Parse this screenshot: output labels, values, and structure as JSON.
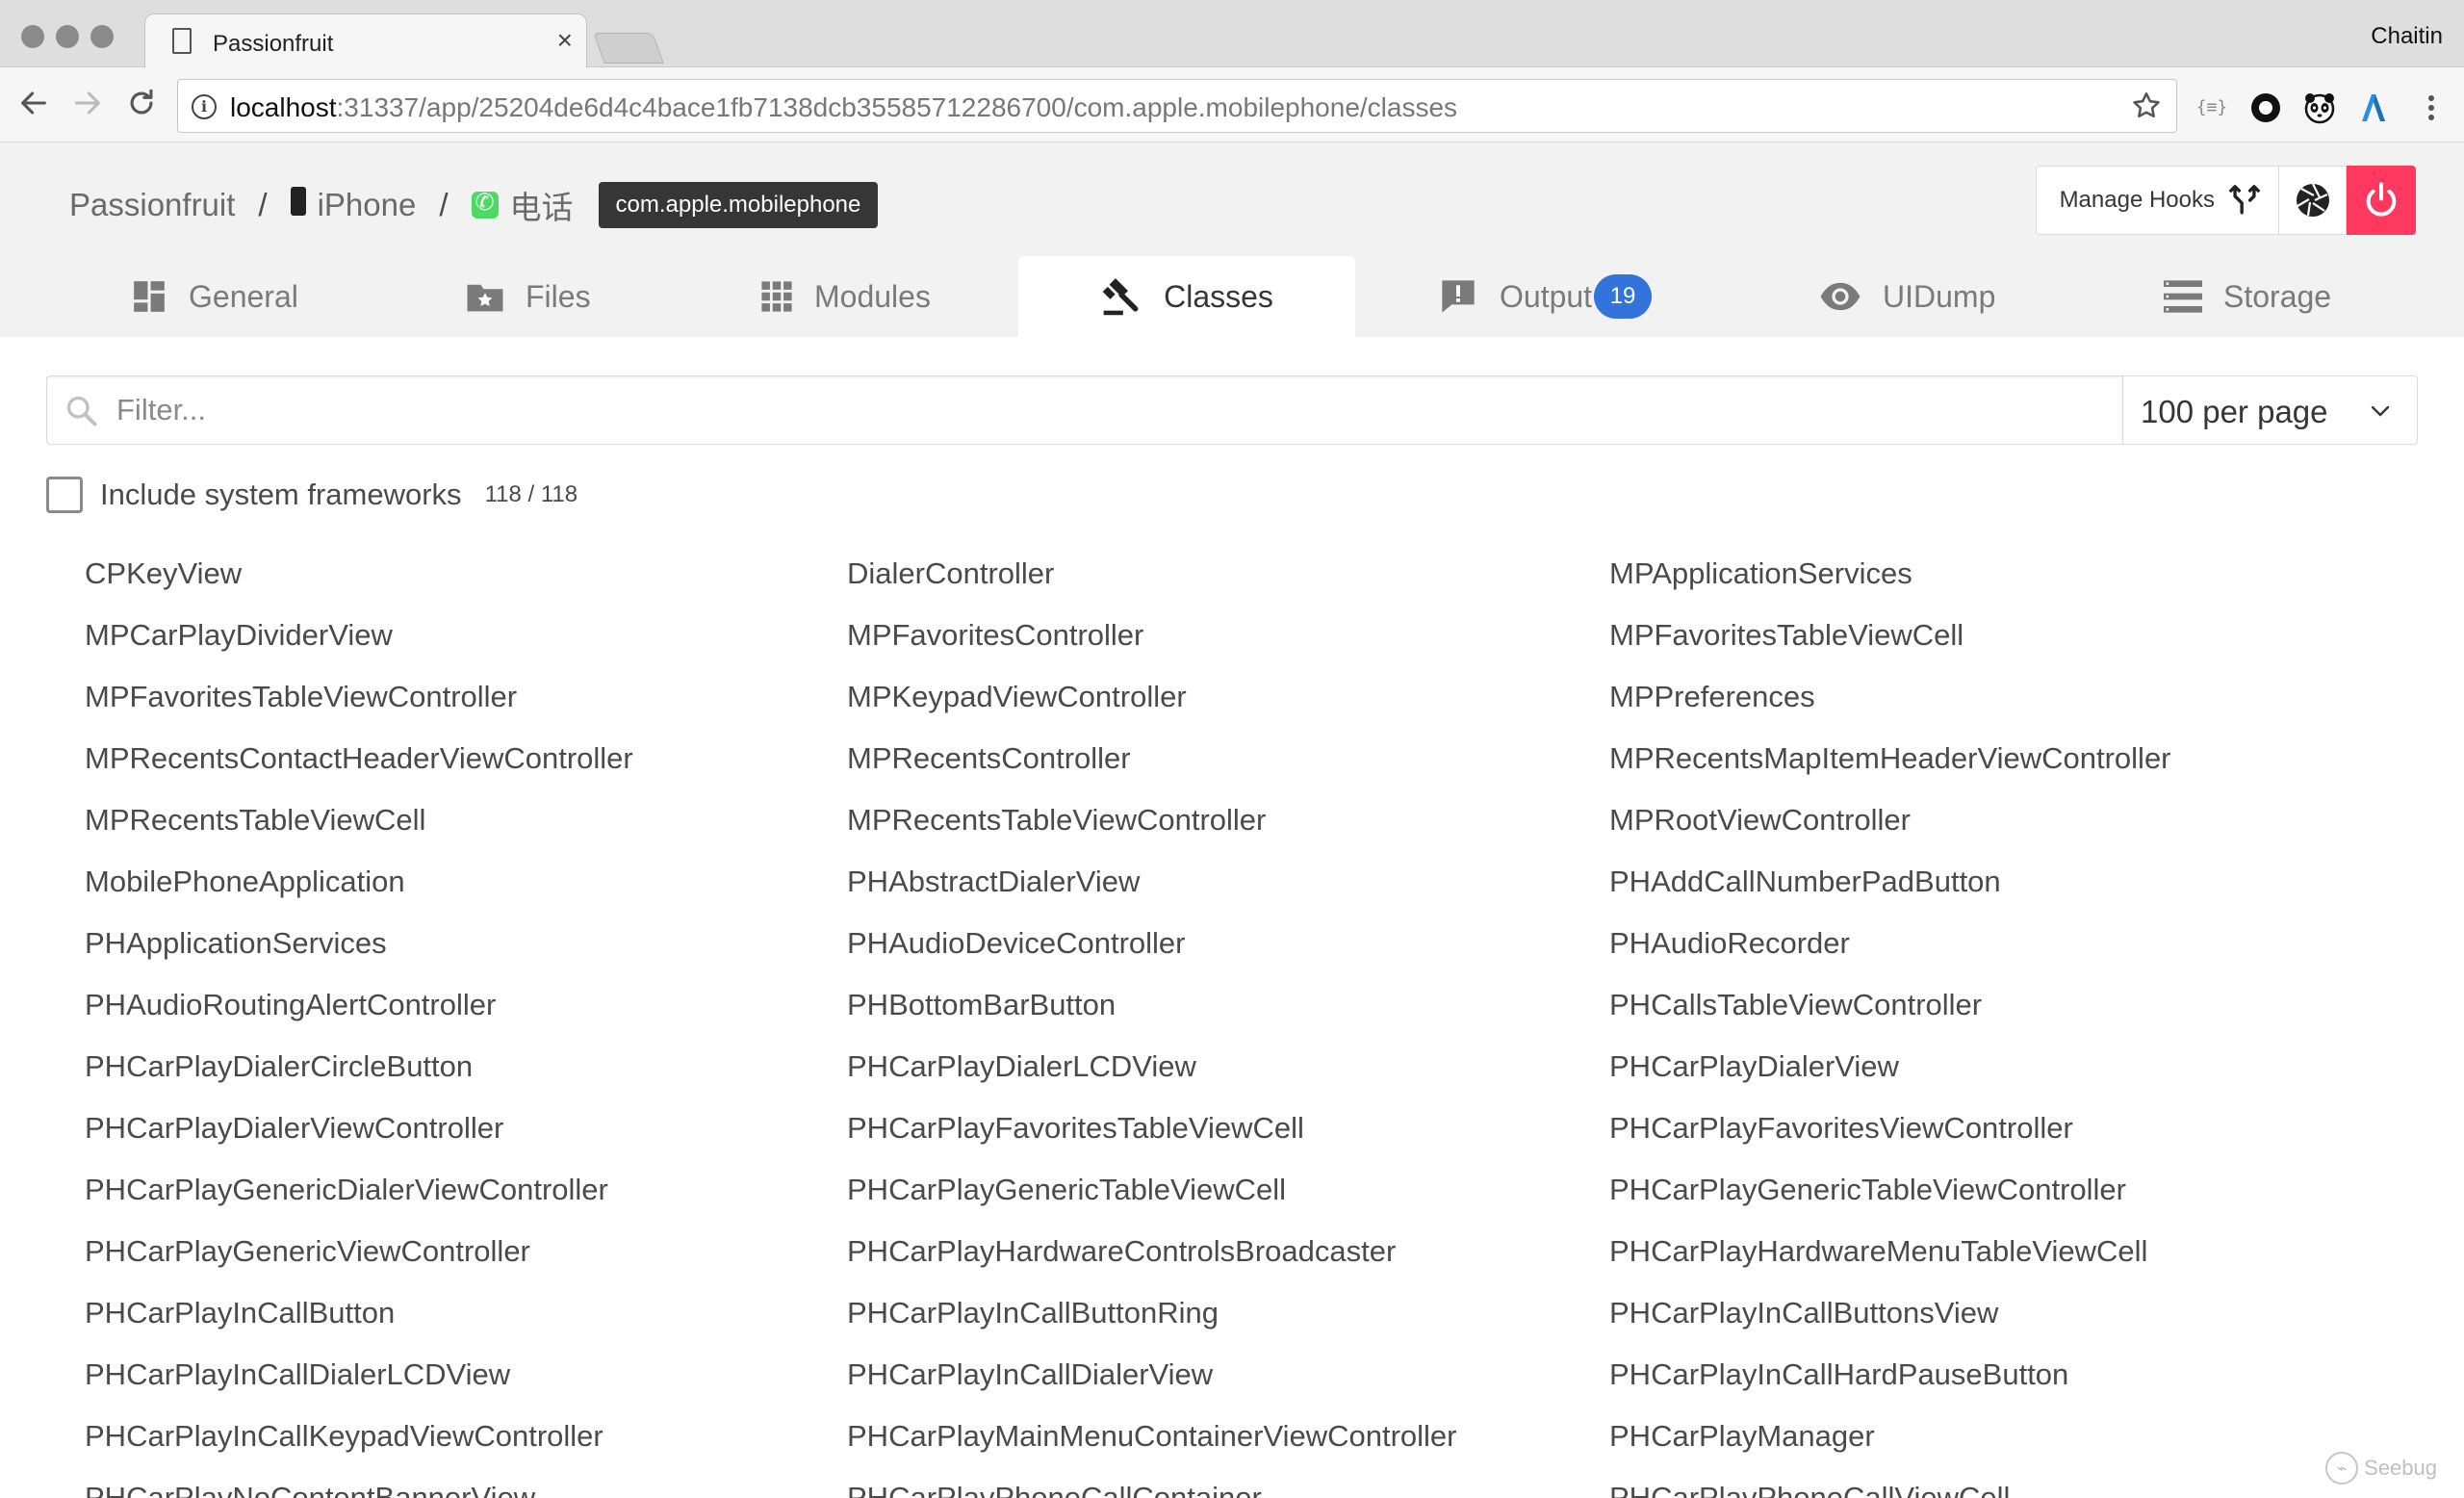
{
  "browser": {
    "tab_title": "Passionfruit",
    "tab_close": "×",
    "profile_name": "Chaitin",
    "url_host": "localhost",
    "url_rest": ":31337/app/25204de6d4c4bace1fb7138dcb35585712286700/com.apple.mobilephone/classes",
    "extensions": [
      "json-viewer-icon",
      "circle-extension-icon",
      "panda-extension-icon",
      "lambda-extension-icon"
    ]
  },
  "breadcrumb": {
    "root": "Passionfruit",
    "separator": "/",
    "device": "iPhone",
    "app_name": "电话",
    "bundle_id": "com.apple.mobilephone"
  },
  "actions": {
    "manage_hooks_label": "Manage Hooks"
  },
  "tabs": [
    {
      "label": "General",
      "icon": "dashboard-icon"
    },
    {
      "label": "Files",
      "icon": "folder-star-icon"
    },
    {
      "label": "Modules",
      "icon": "grid-icon"
    },
    {
      "label": "Classes",
      "icon": "gavel-icon",
      "active": true
    },
    {
      "label": "Output",
      "icon": "alert-message-icon",
      "badge": "19"
    },
    {
      "label": "UIDump",
      "icon": "eye-icon"
    },
    {
      "label": "Storage",
      "icon": "list-icon"
    }
  ],
  "filter": {
    "placeholder": "Filter...",
    "value": "",
    "per_page": "100 per page"
  },
  "system_frameworks": {
    "label": "Include system frameworks",
    "checked": false,
    "count": "118 / 118"
  },
  "classes": {
    "col1": [
      "CPKeyView",
      "MPCarPlayDividerView",
      "MPFavoritesTableViewController",
      "MPRecentsContactHeaderViewController",
      "MPRecentsTableViewCell",
      "MobilePhoneApplication",
      "PHApplicationServices",
      "PHAudioRoutingAlertController",
      "PHCarPlayDialerCircleButton",
      "PHCarPlayDialerViewController",
      "PHCarPlayGenericDialerViewController",
      "PHCarPlayGenericViewController",
      "PHCarPlayInCallButton",
      "PHCarPlayInCallDialerLCDView",
      "PHCarPlayInCallKeypadViewController",
      "PHCarPlayNoContentBannerView"
    ],
    "col2": [
      "DialerController",
      "MPFavoritesController",
      "MPKeypadViewController",
      "MPRecentsController",
      "MPRecentsTableViewController",
      "PHAbstractDialerView",
      "PHAudioDeviceController",
      "PHBottomBarButton",
      "PHCarPlayDialerLCDView",
      "PHCarPlayFavoritesTableViewCell",
      "PHCarPlayGenericTableViewCell",
      "PHCarPlayHardwareControlsBroadcaster",
      "PHCarPlayInCallButtonRing",
      "PHCarPlayInCallDialerView",
      "PHCarPlayMainMenuContainerViewController",
      "PHCarPlayPhoneCallContainer"
    ],
    "col3": [
      "MPApplicationServices",
      "MPFavoritesTableViewCell",
      "MPPreferences",
      "MPRecentsMapItemHeaderViewController",
      "MPRootViewController",
      "PHAddCallNumberPadButton",
      "PHAudioRecorder",
      "PHCallsTableViewController",
      "PHCarPlayDialerView",
      "PHCarPlayFavoritesViewController",
      "PHCarPlayGenericTableViewController",
      "PHCarPlayHardwareMenuTableViewCell",
      "PHCarPlayInCallButtonsView",
      "PHCarPlayInCallHardPauseButton",
      "PHCarPlayManager",
      "PHCarPlayPhoneCallViewCell"
    ]
  },
  "watermark": "Seebug",
  "colors": {
    "accent_blue": "#3273dc",
    "power_red": "#ff3860",
    "tag_dark": "#363636",
    "header_bg": "#f2f2f2"
  }
}
